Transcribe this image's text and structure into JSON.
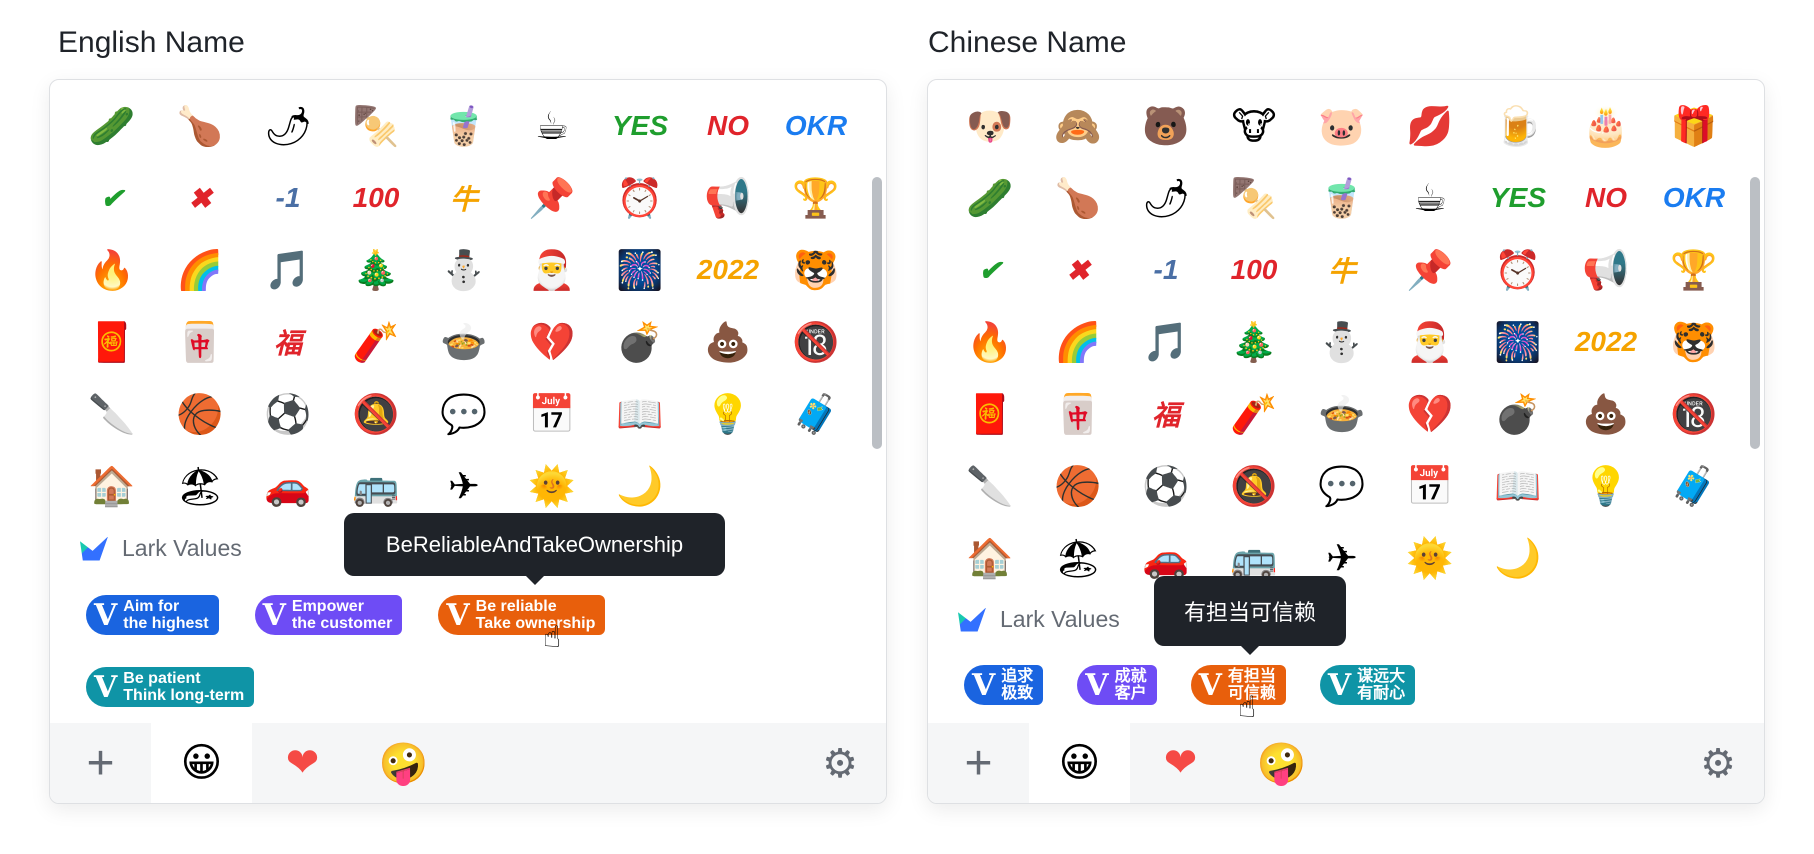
{
  "left": {
    "title": "English Name",
    "section": "Lark Values",
    "tooltip": "BeReliableAndTakeOwnership",
    "badges": [
      {
        "l1": "Aim for",
        "l2": "the highest",
        "color": "#1a64e0"
      },
      {
        "l1": "Empower",
        "l2": "the customer",
        "color": "#6e4cf5"
      },
      {
        "l1": "Be reliable",
        "l2": "Take ownership",
        "color": "#e85f0c"
      },
      {
        "l1": "Be patient",
        "l2": "Think long-term",
        "color": "#0f94a6"
      }
    ]
  },
  "right": {
    "title": "Chinese Name",
    "section": "Lark Values",
    "tooltip": "有担当可信赖",
    "badges": [
      {
        "l1": "追求",
        "l2": "极致",
        "color": "#1a64e0"
      },
      {
        "l1": "成就",
        "l2": "客户",
        "color": "#6e4cf5"
      },
      {
        "l1": "有担当",
        "l2": "可信赖",
        "color": "#e85f0c"
      },
      {
        "l1": "谋远大",
        "l2": "有耐心",
        "color": "#0f94a6"
      }
    ]
  },
  "badge_letter": "V",
  "extra_row": [
    [
      "🐶",
      "doge-icon"
    ],
    [
      "🙈",
      "see-no-evil-monkey-icon"
    ],
    [
      "🐻",
      "bear-icon"
    ],
    [
      "🐮",
      "cow-icon"
    ],
    [
      "🐷",
      "pig-icon"
    ],
    [
      "💋",
      "kiss-icon"
    ],
    [
      "🍺",
      "beer-icon"
    ],
    [
      "🎂",
      "cake-icon"
    ],
    [
      "🎁",
      "gift-icon"
    ]
  ],
  "emoji": [
    [
      "🥒",
      "cucumber-icon"
    ],
    [
      "🍗",
      "drumstick-icon"
    ],
    [
      "🌶",
      "chili-icon"
    ],
    [
      "🍢",
      "skewer-icon"
    ],
    [
      "🧋",
      "bubble-tea-icon"
    ],
    [
      "☕",
      "coffee-icon"
    ],
    [
      "YES",
      "yes-icon",
      "green"
    ],
    [
      "NO",
      "no-icon",
      ""
    ],
    [
      "OKR",
      "okr-icon",
      "blue"
    ],
    [
      "✔",
      "check-icon",
      "green"
    ],
    [
      "✖",
      "cross-icon",
      ""
    ],
    [
      "-1",
      "minus-one-icon",
      "slate"
    ],
    [
      "100",
      "hundred-icon",
      ""
    ],
    [
      "牛",
      "niu-icon",
      "orange"
    ],
    [
      "📌",
      "pin-icon"
    ],
    [
      "⏰",
      "alarm-clock-icon"
    ],
    [
      "📢",
      "megaphone-icon"
    ],
    [
      "🏆",
      "trophy-icon"
    ],
    [
      "🔥",
      "fire-icon"
    ],
    [
      "🌈",
      "rainbow-icon"
    ],
    [
      "🎵",
      "music-note-icon"
    ],
    [
      "🎄",
      "christmas-tree-icon"
    ],
    [
      "⛄",
      "snowman-icon"
    ],
    [
      "🎅",
      "santa-hat-icon"
    ],
    [
      "🎆",
      "fireworks-icon"
    ],
    [
      "2022",
      "year-2022-icon",
      "orange"
    ],
    [
      "🐯",
      "tiger-icon"
    ],
    [
      "🧧",
      "red-envelope-icon"
    ],
    [
      "🀄",
      "fa-tile-icon"
    ],
    [
      "福",
      "fu-icon",
      ""
    ],
    [
      "🧨",
      "firecracker-icon"
    ],
    [
      "🍲",
      "tangyuan-bowl-icon"
    ],
    [
      "💔",
      "broken-heart-icon"
    ],
    [
      "💣",
      "bomb-icon"
    ],
    [
      "💩",
      "poop-icon"
    ],
    [
      "🔞",
      "no-under-18-icon"
    ],
    [
      "🔪",
      "cleaver-icon"
    ],
    [
      "🏀",
      "basketball-icon"
    ],
    [
      "⚽",
      "soccer-icon"
    ],
    [
      "🔕",
      "bell-mute-icon"
    ],
    [
      "💬",
      "chat-bubble-icon"
    ],
    [
      "📅",
      "calendar-icon"
    ],
    [
      "📖",
      "book-icon"
    ],
    [
      "💡",
      "lightbulb-icon"
    ],
    [
      "🧳",
      "luggage-icon"
    ],
    [
      "🏠",
      "house-icon"
    ],
    [
      "🏖",
      "beach-icon"
    ],
    [
      "🚗",
      "car-icon"
    ],
    [
      "🚌",
      "bus-icon"
    ],
    [
      "✈",
      "airplane-icon"
    ],
    [
      "🌞",
      "sun-icon"
    ],
    [
      "🌙",
      "moon-icon"
    ]
  ],
  "footer": {
    "tabs": [
      [
        "+",
        "add-icon"
      ],
      [
        "😀",
        "smile-icon"
      ],
      [
        "❤",
        "heart-icon"
      ],
      [
        "🤪",
        "custom-sticker-icon"
      ]
    ],
    "gear": "⚙"
  }
}
